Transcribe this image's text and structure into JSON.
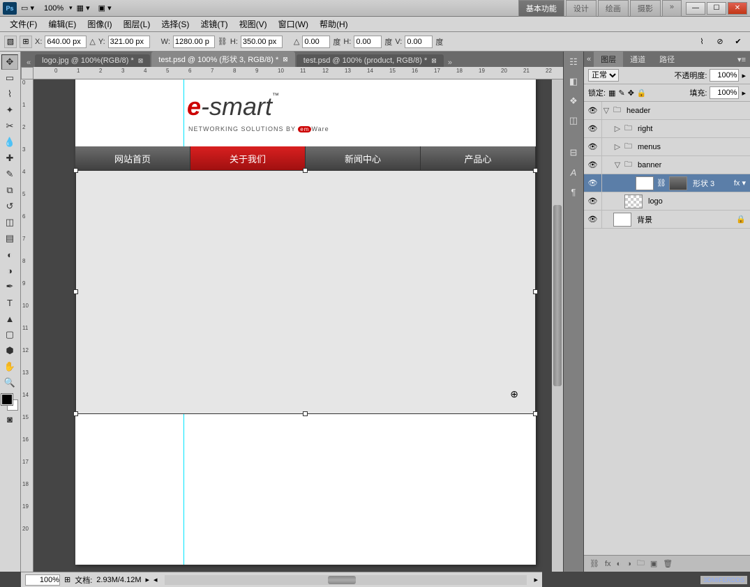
{
  "titlebar": {
    "zoom": "100%"
  },
  "workspaces": [
    "基本功能",
    "设计",
    "绘画",
    "摄影"
  ],
  "menu": [
    "文件(F)",
    "编辑(E)",
    "图像(I)",
    "图层(L)",
    "选择(S)",
    "滤镜(T)",
    "视图(V)",
    "窗口(W)",
    "帮助(H)"
  ],
  "options": {
    "x_label": "X:",
    "x": "640.00 px",
    "y_label": "Y:",
    "y": "321.00 px",
    "w_label": "W:",
    "w": "1280.00 p",
    "h_label": "H:",
    "h": "350.00 px",
    "a1_label": "△",
    "a1": "0.00",
    "a1_unit": "度",
    "a2_label": "H:",
    "a2": "0.00",
    "a2_unit": "度",
    "a3_label": "V:",
    "a3": "0.00",
    "a3_unit": "度"
  },
  "tabs": [
    {
      "label": "logo.jpg @ 100%(RGB/8) *"
    },
    {
      "label": "test.psd @ 100% (形状 3, RGB/8) *",
      "active": true
    },
    {
      "label": "test.psd @ 100% (product, RGB/8) *"
    }
  ],
  "ruler_h": [
    0,
    1,
    2,
    3,
    4,
    5,
    6,
    7,
    8,
    9,
    10,
    11,
    12,
    13,
    14,
    15,
    16,
    17,
    18,
    19,
    20,
    21,
    22
  ],
  "ruler_v": [
    0,
    1,
    2,
    3,
    4,
    5,
    6,
    7,
    8,
    9,
    10,
    11,
    12,
    13,
    14,
    15,
    16,
    17,
    18,
    19,
    20
  ],
  "logo": {
    "brand_e": "e",
    "brand_rest": "-smart",
    "tm": "™",
    "sub_pre": "NETWORKING SOLUTIONS BY ",
    "sub_em": "em",
    "sub_post": "Ware"
  },
  "nav": [
    "网站首页",
    "关于我们",
    "新闻中心",
    "产品心"
  ],
  "layers_panel": {
    "tabs": [
      "图层",
      "通道",
      "路径"
    ],
    "blend": "正常",
    "opacity_label": "不透明度:",
    "opacity": "100%",
    "lock_label": "锁定:",
    "fill_label": "填充:",
    "fill": "100%"
  },
  "layers": [
    {
      "indent": 0,
      "name": "header",
      "arrow": "▽",
      "folder": true
    },
    {
      "indent": 1,
      "name": "right",
      "arrow": "▷",
      "folder": true
    },
    {
      "indent": 1,
      "name": "menus",
      "arrow": "▷",
      "folder": true
    },
    {
      "indent": 1,
      "name": "banner",
      "arrow": "▽",
      "folder": true
    },
    {
      "indent": 2,
      "name": "形状 3",
      "sel": true,
      "fx": "fx ▾",
      "mask": true
    },
    {
      "indent": 1,
      "name": "logo",
      "checker": true
    },
    {
      "indent": 0,
      "name": "背景",
      "lock": "🔒"
    }
  ],
  "status": {
    "zoom": "100%",
    "doc_label": "文档:",
    "doc": "2.93M/4.12M"
  },
  "watermark": "3DMIFERDDS"
}
